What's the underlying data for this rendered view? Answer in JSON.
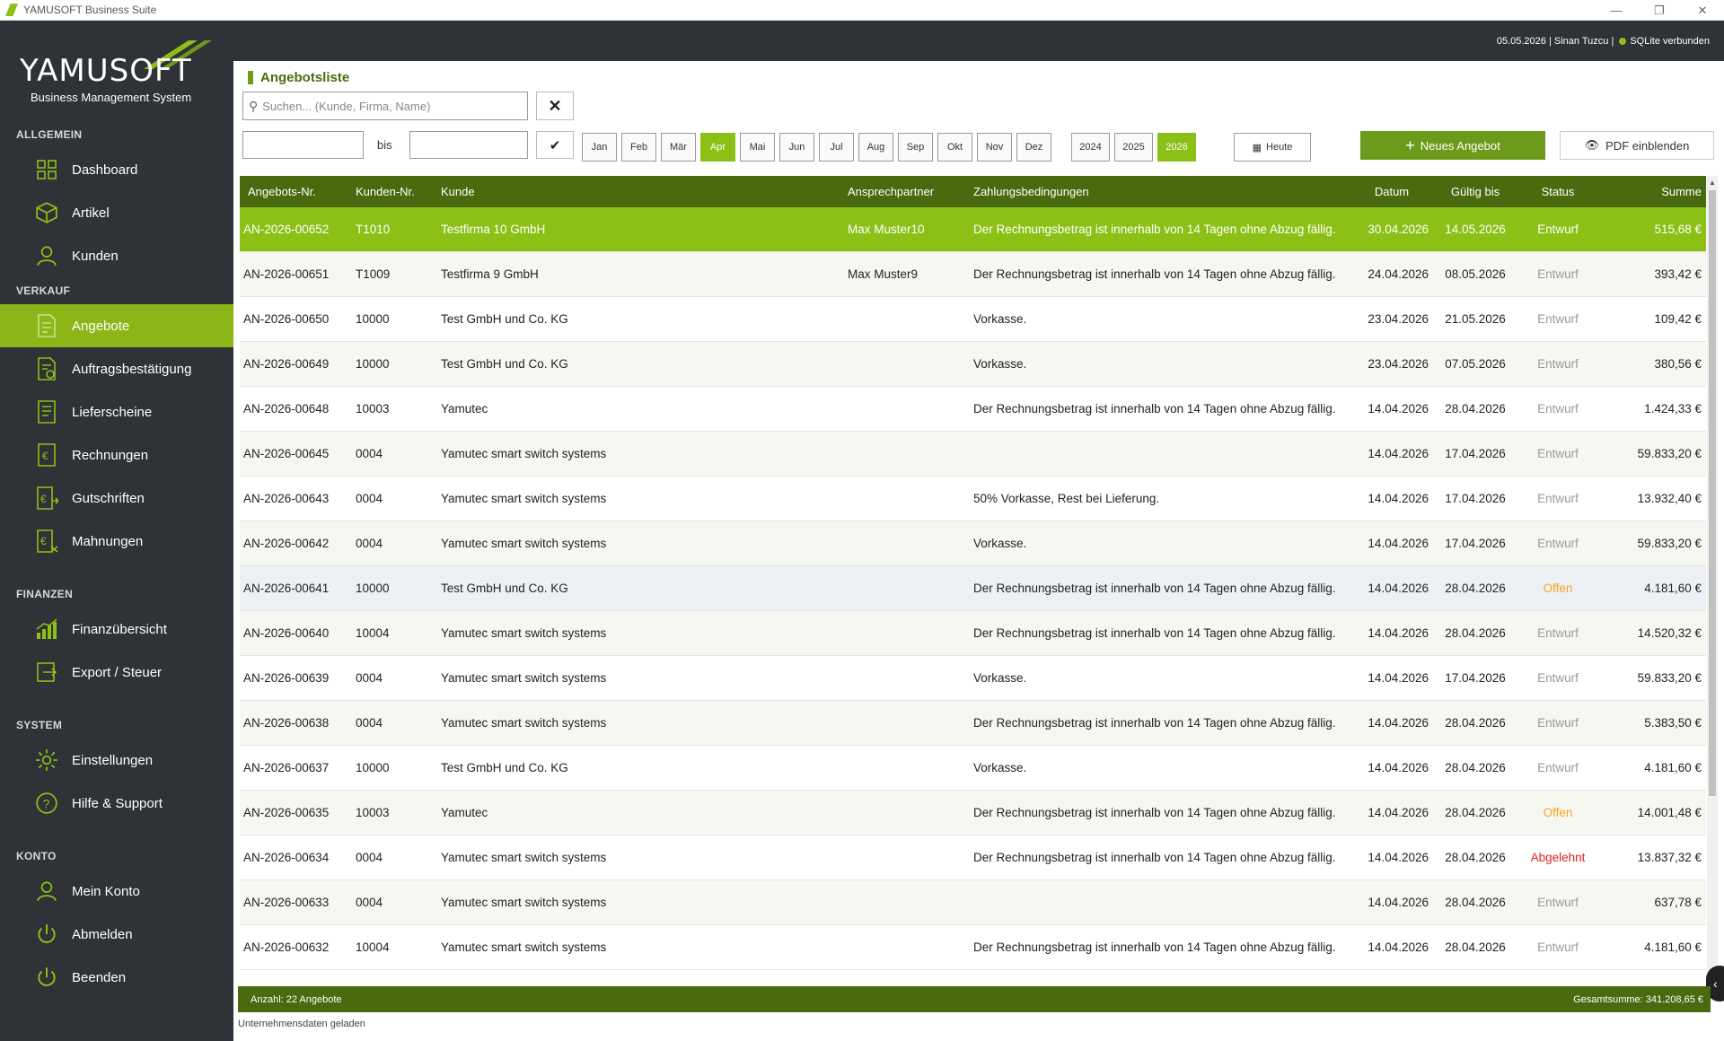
{
  "window": {
    "title": "YAMUSOFT Business Suite"
  },
  "brand": {
    "logo": "YAMUSOFT",
    "subtitle": "Business Management System"
  },
  "topbar": {
    "info": "05.05.2026 | Sinan Tuzcu |",
    "db_status": "SQLite verbunden"
  },
  "sidebar": {
    "sections": {
      "allgemein": "ALLGEMEIN",
      "verkauf": "VERKAUF",
      "finanzen": "FINANZEN",
      "system": "SYSTEM",
      "konto": "KONTO"
    },
    "items": {
      "dashboard": "Dashboard",
      "artikel": "Artikel",
      "kunden": "Kunden",
      "angebote": "Angebote",
      "auftrag": "Auftragsbestätigung",
      "liefer": "Lieferscheine",
      "rechnungen": "Rechnungen",
      "gutschriften": "Gutschriften",
      "mahnungen": "Mahnungen",
      "finanz": "Finanzübersicht",
      "export": "Export / Steuer",
      "einstellungen": "Einstellungen",
      "hilfe": "Hilfe & Support",
      "konto": "Mein Konto",
      "abmelden": "Abmelden",
      "beenden": "Beenden"
    }
  },
  "page": {
    "title": "Angebotsliste",
    "search_placeholder": "Suchen... (Kunde, Firma, Name)",
    "bis": "bis",
    "months": [
      "Jan",
      "Feb",
      "Mär",
      "Apr",
      "Mai",
      "Jun",
      "Jul",
      "Aug",
      "Sep",
      "Okt",
      "Nov",
      "Dez"
    ],
    "active_month": "Apr",
    "years": [
      "2024",
      "2025",
      "2026"
    ],
    "active_year": "2026",
    "today": "Heute",
    "new": "Neues Angebot",
    "pdf": "PDF einblenden"
  },
  "table": {
    "headers": [
      "Angebots-Nr.",
      "Kunden-Nr.",
      "Kunde",
      "Ansprechpartner",
      "Zahlungsbedingungen",
      "Datum",
      "Gültig bis",
      "Status",
      "Summe"
    ],
    "rows": [
      [
        "AN-2026-00652",
        "T1010",
        "Testfirma 10 GmbH",
        "Max Muster10",
        "Der Rechnungsbetrag ist innerhalb von 14 Tagen ohne Abzug fällig.",
        "30.04.2026",
        "14.05.2026",
        "Entwurf",
        "515,68 €"
      ],
      [
        "AN-2026-00651",
        "T1009",
        "Testfirma 9 GmbH",
        "Max Muster9",
        "Der Rechnungsbetrag ist innerhalb von 14 Tagen ohne Abzug fällig.",
        "24.04.2026",
        "08.05.2026",
        "Entwurf",
        "393,42 €"
      ],
      [
        "AN-2026-00650",
        "10000",
        "Test GmbH und Co. KG",
        "",
        "Vorkasse.",
        "23.04.2026",
        "21.05.2026",
        "Entwurf",
        "109,42 €"
      ],
      [
        "AN-2026-00649",
        "10000",
        "Test GmbH und Co. KG",
        "",
        "Vorkasse.",
        "23.04.2026",
        "07.05.2026",
        "Entwurf",
        "380,56 €"
      ],
      [
        "AN-2026-00648",
        "10003",
        "Yamutec",
        "",
        "Der Rechnungsbetrag ist innerhalb von 14 Tagen ohne Abzug fällig.",
        "14.04.2026",
        "28.04.2026",
        "Entwurf",
        "1.424,33 €"
      ],
      [
        "AN-2026-00645",
        "0004",
        "Yamutec smart switch systems",
        "",
        "",
        "14.04.2026",
        "17.04.2026",
        "Entwurf",
        "59.833,20 €"
      ],
      [
        "AN-2026-00643",
        "0004",
        "Yamutec smart switch systems",
        "",
        "50% Vorkasse, Rest bei Lieferung.",
        "14.04.2026",
        "17.04.2026",
        "Entwurf",
        "13.932,40 €"
      ],
      [
        "AN-2026-00642",
        "0004",
        "Yamutec smart switch systems",
        "",
        "Vorkasse.",
        "14.04.2026",
        "17.04.2026",
        "Entwurf",
        "59.833,20 €"
      ],
      [
        "AN-2026-00641",
        "10000",
        "Test GmbH und Co. KG",
        "",
        "Der Rechnungsbetrag ist innerhalb von 14 Tagen ohne Abzug fällig.",
        "14.04.2026",
        "28.04.2026",
        "Offen",
        "4.181,60 €"
      ],
      [
        "AN-2026-00640",
        "10004",
        "Yamutec smart switch systems",
        "",
        "Der Rechnungsbetrag ist innerhalb von 14 Tagen ohne Abzug fällig.",
        "14.04.2026",
        "28.04.2026",
        "Entwurf",
        "14.520,32 €"
      ],
      [
        "AN-2026-00639",
        "0004",
        "Yamutec smart switch systems",
        "",
        "Vorkasse.",
        "14.04.2026",
        "17.04.2026",
        "Entwurf",
        "59.833,20 €"
      ],
      [
        "AN-2026-00638",
        "0004",
        "Yamutec smart switch systems",
        "",
        "Der Rechnungsbetrag ist innerhalb von 14 Tagen ohne Abzug fällig.",
        "14.04.2026",
        "28.04.2026",
        "Entwurf",
        "5.383,50 €"
      ],
      [
        "AN-2026-00637",
        "10000",
        "Test GmbH und Co. KG",
        "",
        "Vorkasse.",
        "14.04.2026",
        "28.04.2026",
        "Entwurf",
        "4.181,60 €"
      ],
      [
        "AN-2026-00635",
        "10003",
        "Yamutec",
        "",
        "Der Rechnungsbetrag ist innerhalb von 14 Tagen ohne Abzug fällig.",
        "14.04.2026",
        "28.04.2026",
        "Offen",
        "14.001,48 €"
      ],
      [
        "AN-2026-00634",
        "0004",
        "Yamutec smart switch systems",
        "",
        "Der Rechnungsbetrag ist innerhalb von 14 Tagen ohne Abzug fällig.",
        "14.04.2026",
        "28.04.2026",
        "Abgelehnt",
        "13.837,32 €"
      ],
      [
        "AN-2026-00633",
        "0004",
        "Yamutec smart switch systems",
        "",
        "",
        "14.04.2026",
        "28.04.2026",
        "Entwurf",
        "637,78 €"
      ],
      [
        "AN-2026-00632",
        "10004",
        "Yamutec smart switch systems",
        "",
        "Der Rechnungsbetrag ist innerhalb von 14 Tagen ohne Abzug fällig.",
        "14.04.2026",
        "28.04.2026",
        "Entwurf",
        "4.181,60 €"
      ]
    ]
  },
  "footer": {
    "count": "Anzahl: 22 Angebote",
    "total": "Gesamtsumme: 341.208,65 €"
  },
  "statusbar": {
    "text": "Unternehmensdaten geladen"
  },
  "colors": {
    "accent": "#8cc017",
    "dark_green": "#4a6a0f",
    "sidebar": "#2f3237",
    "offen": "#f5a623",
    "abgelehnt": "#e02020"
  }
}
